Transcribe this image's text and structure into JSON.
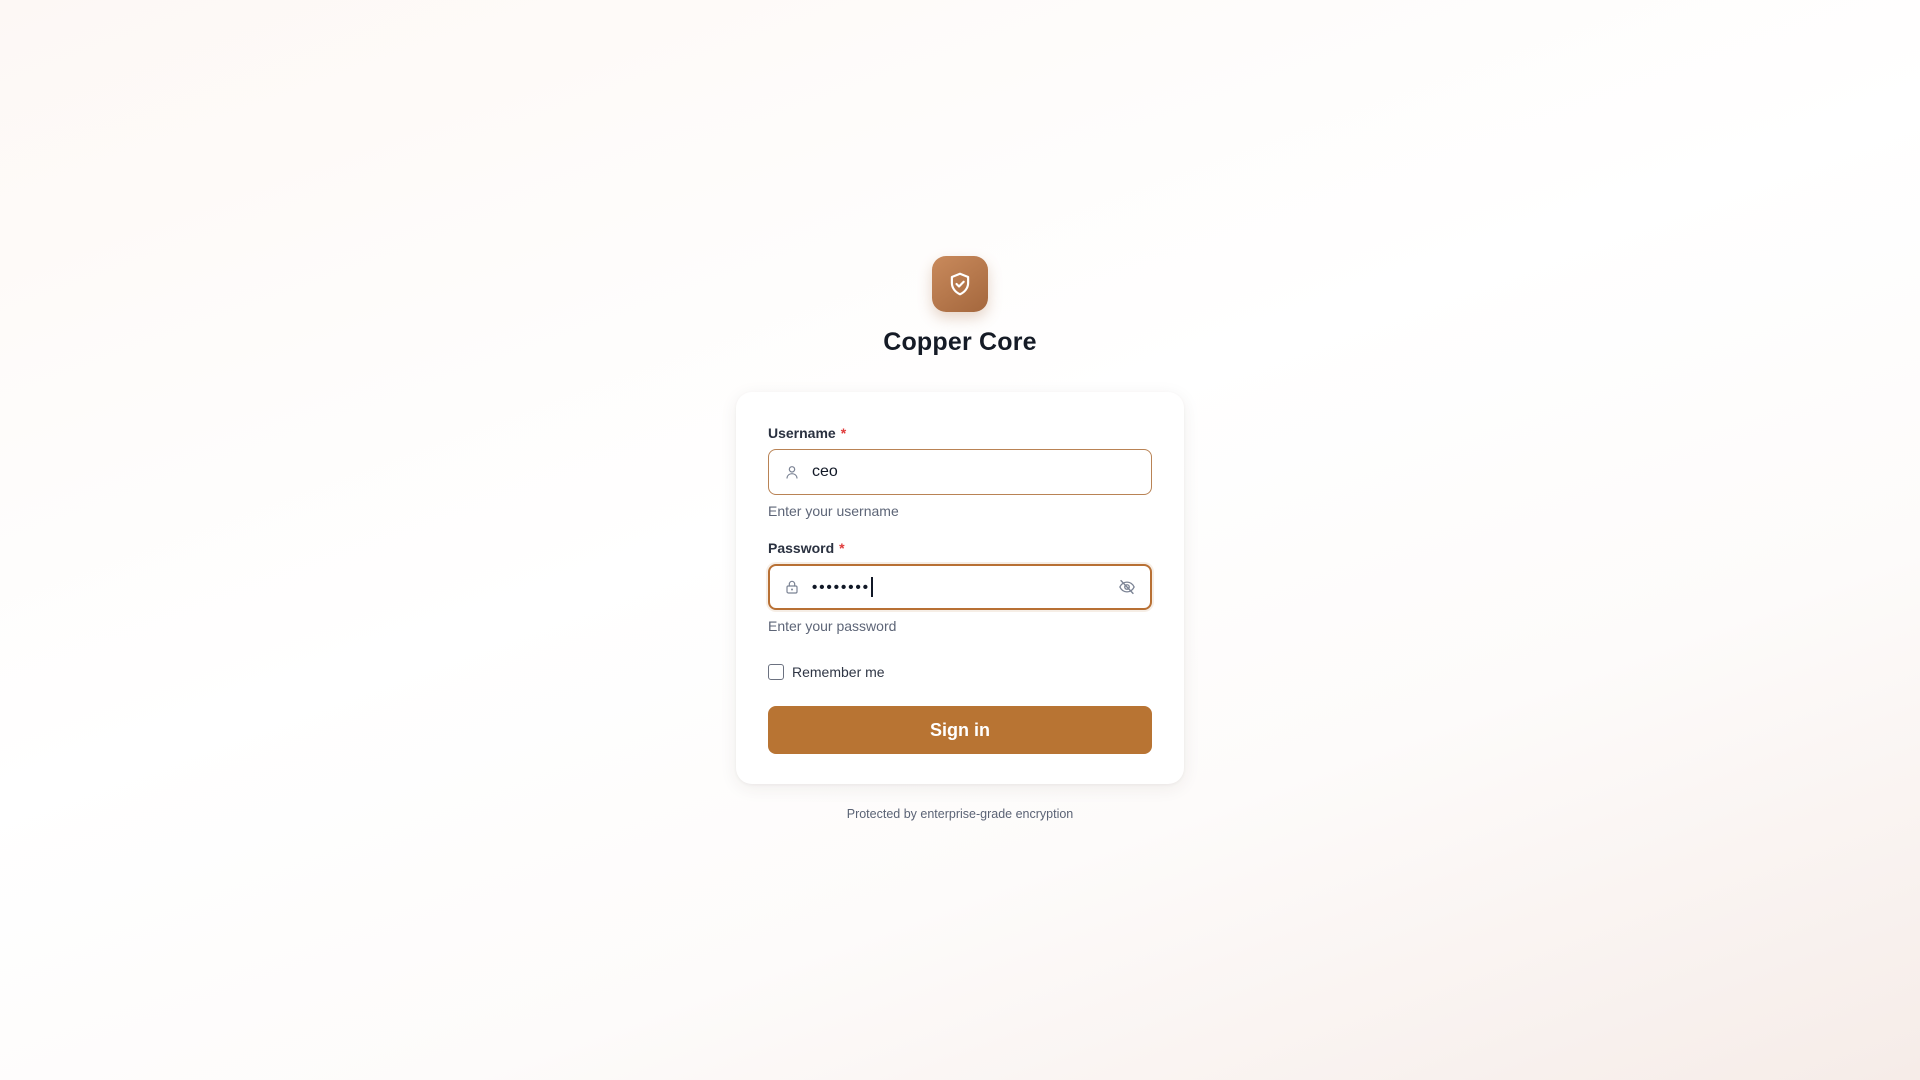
{
  "brand": {
    "logo_icon": "shield-check-icon",
    "app_name": "Copper Core"
  },
  "form": {
    "username": {
      "label": "Username",
      "required_marker": "*",
      "icon": "user-icon",
      "value": "ceo",
      "hint": "Enter your username"
    },
    "password": {
      "label": "Password",
      "required_marker": "*",
      "icon": "lock-icon",
      "value_masked": "••••••••",
      "toggle_icon": "eye-off-icon",
      "hint": "Enter your password",
      "focused": true
    },
    "remember": {
      "label": "Remember me",
      "checked": false
    },
    "submit_label": "Sign in"
  },
  "footer": {
    "note": "Protected by enterprise-grade encryption"
  },
  "colors": {
    "accent": "#b87433",
    "logo_gradient_start": "#c98a5c",
    "logo_gradient_end": "#a4673d",
    "required": "#e03b3b"
  }
}
